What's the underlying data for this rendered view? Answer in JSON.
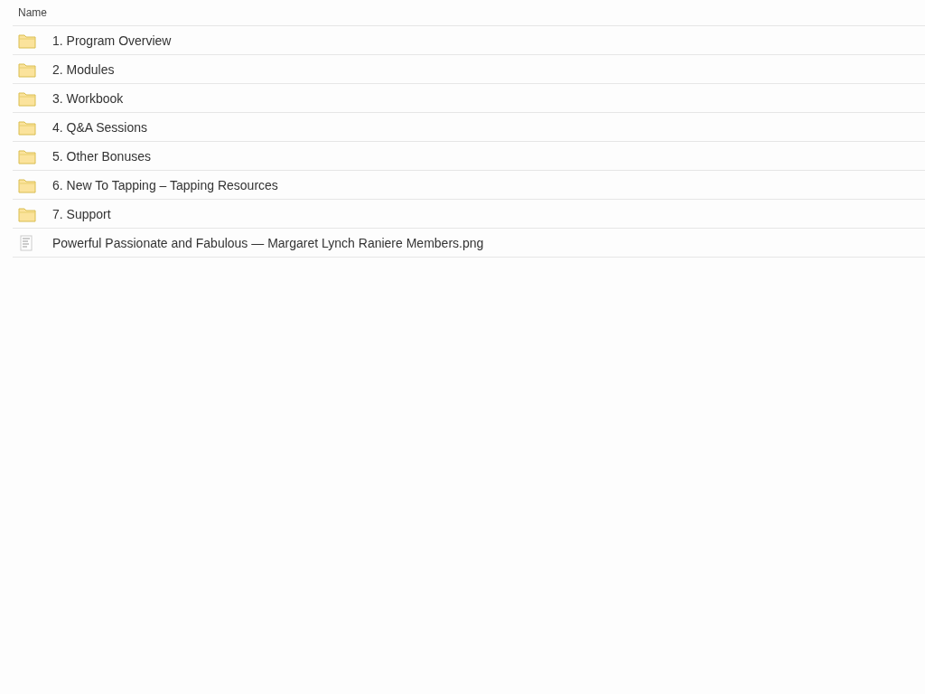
{
  "table": {
    "columns": [
      "Name"
    ],
    "rows": [
      {
        "kind": "folder",
        "name": "1. Program Overview"
      },
      {
        "kind": "folder",
        "name": "2. Modules"
      },
      {
        "kind": "folder",
        "name": "3. Workbook"
      },
      {
        "kind": "folder",
        "name": "4. Q&A Sessions"
      },
      {
        "kind": "folder",
        "name": "5. Other Bonuses"
      },
      {
        "kind": "folder",
        "name": "6. New To Tapping – Tapping Resources"
      },
      {
        "kind": "folder",
        "name": "7. Support"
      },
      {
        "kind": "file",
        "name": "Powerful Passionate and Fabulous — Margaret Lynch Raniere Members.png"
      }
    ]
  }
}
